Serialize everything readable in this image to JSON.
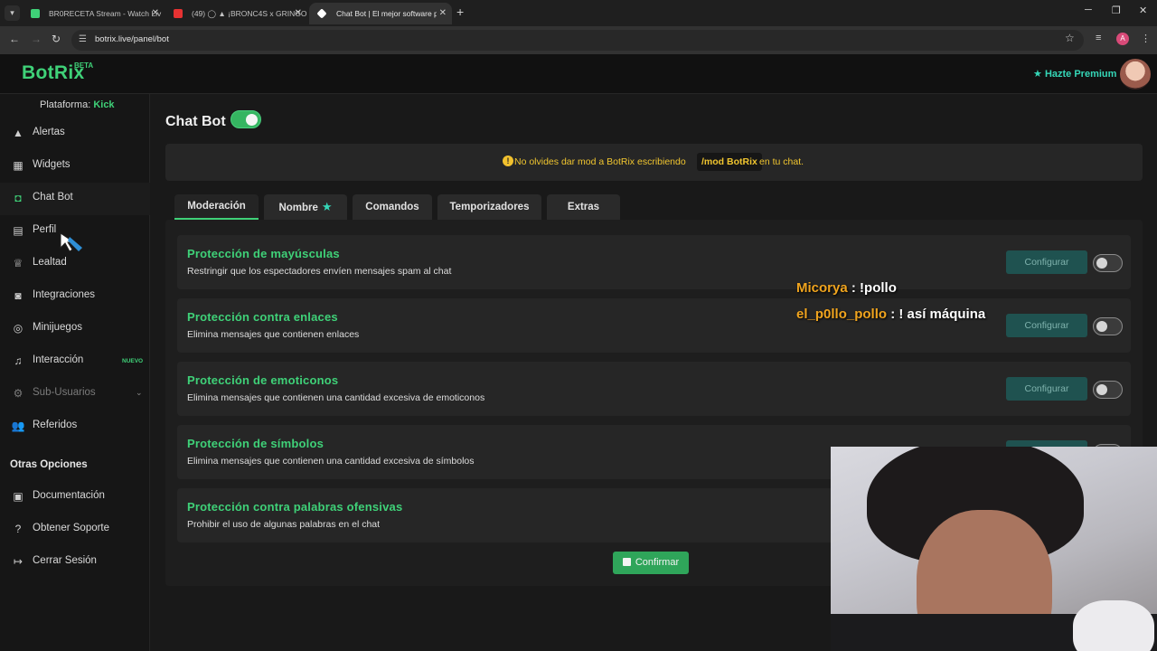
{
  "browser": {
    "tabs": [
      {
        "title": "BR0RECETA Stream - Watch Liv",
        "color": "#3fd178",
        "active": false
      },
      {
        "title": "(49) ◯ ▲ ¡BRONC4S x GRINGO",
        "color": "#e63232",
        "active": false
      },
      {
        "title": "Chat Bot | El mejor software pa",
        "color": "#ffffff",
        "active": true
      }
    ],
    "url": "botrix.live/panel/bot",
    "profile_initial": "A"
  },
  "header": {
    "logo": "BotRix",
    "beta": "BETA",
    "premium_label": "Hazte Premium"
  },
  "sidebar": {
    "platform_label": "Plataforma:",
    "platform_value": "Kick",
    "items": [
      {
        "label": "Alertas",
        "icon": "warning-icon"
      },
      {
        "label": "Widgets",
        "icon": "grid-icon"
      },
      {
        "label": "Chat Bot",
        "icon": "robot-icon"
      },
      {
        "label": "Perfil",
        "icon": "id-card-icon"
      },
      {
        "label": "Lealtad",
        "icon": "trophy-icon"
      },
      {
        "label": "Integraciones",
        "icon": "plug-icon"
      },
      {
        "label": "Minijuegos",
        "icon": "gamepad-icon"
      },
      {
        "label": "Interacción",
        "icon": "music-icon",
        "badge": "NUEVO"
      },
      {
        "label": "Sub-Usuarios",
        "icon": "gear-icon"
      },
      {
        "label": "Referidos",
        "icon": "users-icon"
      }
    ],
    "other_title": "Otras Opciones",
    "other_items": [
      {
        "label": "Documentación",
        "icon": "book-icon"
      },
      {
        "label": "Obtener Soporte",
        "icon": "question-icon"
      },
      {
        "label": "Cerrar Sesión",
        "icon": "logout-icon"
      }
    ]
  },
  "main": {
    "title": "Chat Bot",
    "bot_enabled": true,
    "notice": {
      "before": "No olvides dar mod a BotRix escribiendo",
      "code": "/mod BotRix",
      "after": "en tu chat."
    },
    "tabs": [
      "Moderación",
      "Nombre",
      "Comandos",
      "Temporizadores",
      "Extras"
    ],
    "active_tab": "Moderación",
    "cards": [
      {
        "title": "Protección de mayúsculas",
        "desc": "Restringir que los espectadores envíen mensajes spam al chat",
        "enabled": false
      },
      {
        "title": "Protección contra enlaces",
        "desc": "Elimina mensajes que contienen enlaces",
        "enabled": false
      },
      {
        "title": "Protección de emoticonos",
        "desc": "Elimina mensajes que contienen una cantidad excesiva de emoticonos",
        "enabled": false
      },
      {
        "title": "Protección de símbolos",
        "desc": "Elimina mensajes que contienen una cantidad excesiva de símbolos",
        "enabled": false
      },
      {
        "title": "Protección contra palabras ofensivas",
        "desc": "Prohibir el uso de algunas palabras en el chat",
        "enabled": false
      }
    ],
    "configure_label": "Configurar",
    "confirm_label": "Confirmar"
  },
  "stream_chat": [
    {
      "user": "Micorya",
      "message": ": !pollo"
    },
    {
      "user": "el_p0llo_pollo",
      "message": ": ! así máquina"
    }
  ]
}
